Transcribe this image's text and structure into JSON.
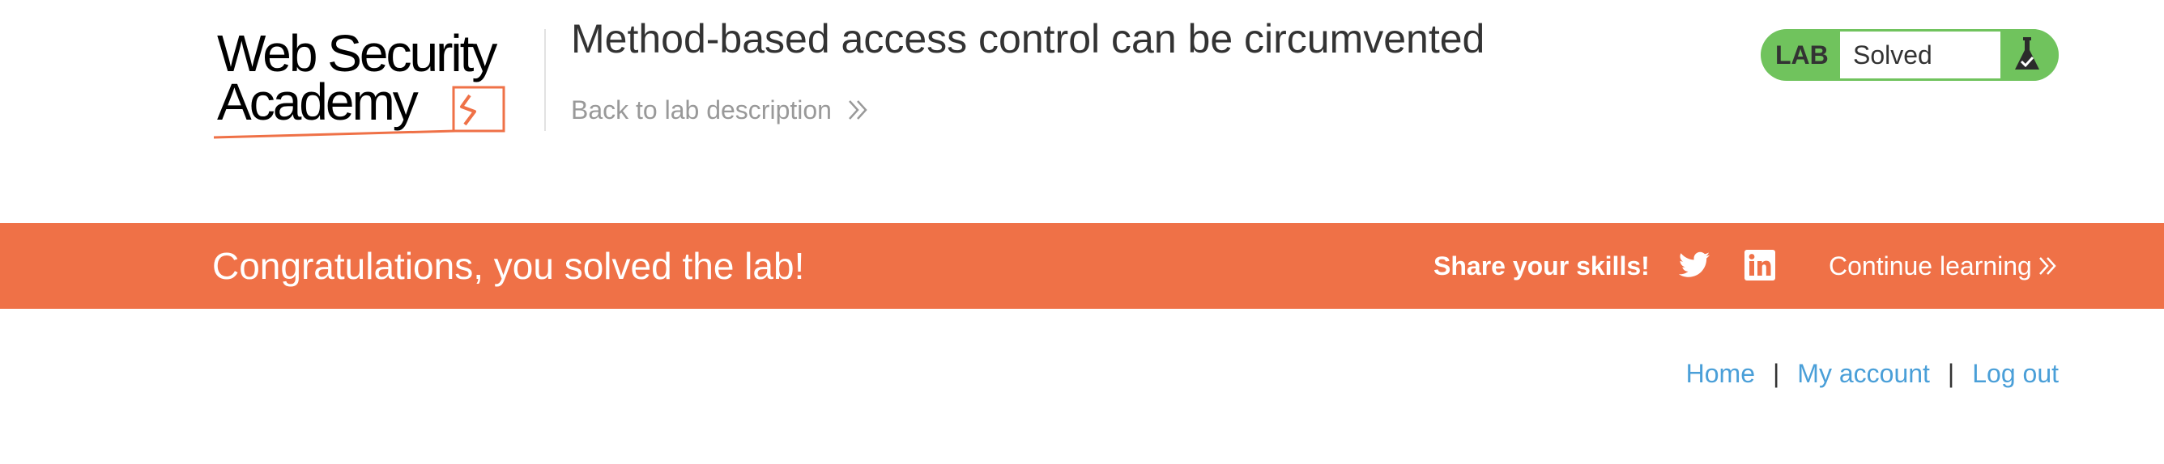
{
  "header": {
    "logo_line1": "Web Security",
    "logo_line2": "Academy",
    "lab_title": "Method-based access control can be circumvented",
    "back_link": "Back to lab description"
  },
  "lab_status": {
    "label": "LAB",
    "status": "Solved",
    "icon": "flask-icon",
    "color_green": "#70c35d"
  },
  "banner": {
    "message": "Congratulations, you solved the lab!",
    "share_label": "Share your skills!",
    "continue_label": "Continue learning",
    "color": "#ef7147"
  },
  "nav": {
    "items": [
      {
        "label": "Home"
      },
      {
        "label": "My account"
      },
      {
        "label": "Log out"
      }
    ],
    "separator": "|",
    "link_color": "#4a9fd8"
  }
}
